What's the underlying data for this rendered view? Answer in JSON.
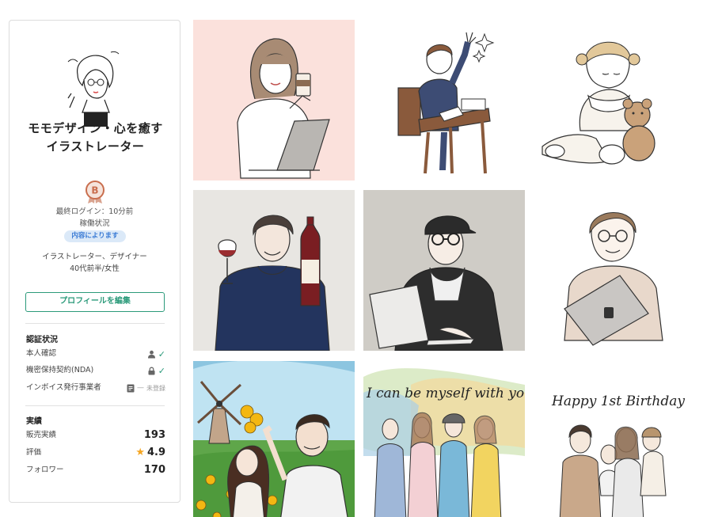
{
  "profile": {
    "name": "モモデザイン・心を癒すイラストレーター",
    "rank": "B",
    "last_login": "最終ログイン：10分前",
    "status_label": "稼働状況",
    "status_badge": "内容によります",
    "occupation": "イラストレーター、デザイナー",
    "age_gender": "40代前半/女性",
    "edit_button": "プロフィールを編集"
  },
  "verification": {
    "title": "認証状況",
    "items": [
      {
        "label": "本人確認",
        "icon": "person-icon",
        "status": "verified"
      },
      {
        "label": "機密保持契約(NDA)",
        "icon": "lock-icon",
        "status": "verified"
      },
      {
        "label": "インボイス発行事業者",
        "icon": "document-icon",
        "status_text": "未登録"
      }
    ]
  },
  "achievements": {
    "title": "実績",
    "sales_label": "販売実績",
    "sales_value": "193",
    "rating_label": "評価",
    "rating_value": "4.9",
    "followers_label": "フォロワー",
    "followers_value": "170"
  },
  "gallery": {
    "tiles": [
      {
        "name": "woman-coffee-laptop"
      },
      {
        "name": "student-raising-hand"
      },
      {
        "name": "child-with-teddy"
      },
      {
        "name": "man-with-wine"
      },
      {
        "name": "man-cap-laptop"
      },
      {
        "name": "woman-with-tablet"
      },
      {
        "name": "couple-windmill-sunflowers"
      },
      {
        "name": "group-watercolor",
        "text": "I can be myself with you"
      },
      {
        "name": "family-birthday",
        "text": "Happy 1st Birthday"
      }
    ]
  },
  "colors": {
    "accent": "#2b9a7a",
    "badge_bg": "#dbe9f8",
    "badge_text": "#3a7bd5",
    "star": "#f5a623",
    "rank_badge": "#c96e4e"
  }
}
